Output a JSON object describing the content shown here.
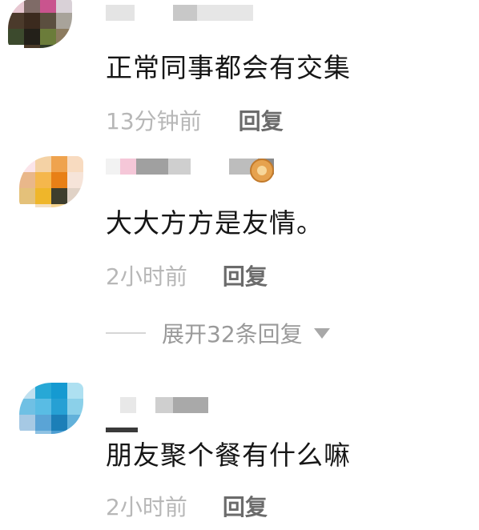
{
  "comments": [
    {
      "text": "正常同事都会有交集",
      "time": "13分钟前",
      "reply_label": "回复",
      "avatar_colors": [
        "#e7c7d1",
        "#7f6b67",
        "#c9548e",
        "#d9d1d7",
        "#4b3a2b",
        "#3b2a1e",
        "#5b4f3f",
        "#a8a39a",
        "#3c4a2d",
        "#232019",
        "#6b7c3a",
        "#8c7b5f",
        "#ffffff",
        "#4a3a29",
        "#2f3a26",
        "#cfa08b"
      ]
    },
    {
      "text": "大大方方是友情。",
      "time": "2小时前",
      "reply_label": "回复",
      "expand_label": "展开32条回复",
      "avatar_colors": [
        "#fbe4e9",
        "#f4d2a5",
        "#efa34e",
        "#f8dbc0",
        "#e9b78a",
        "#f5b74c",
        "#e88016",
        "#f6e4d9",
        "#e4c17a",
        "#efb62a",
        "#3e3e2d",
        "#e0d2c6",
        "#ffffff",
        "#f4e0c2",
        "#f7d590",
        "#a8b060"
      ]
    },
    {
      "text": "朋友聚个餐有什么嘛",
      "time": "2小时前",
      "reply_label": "回复",
      "avatar_colors": [
        "#bfe0ef",
        "#27a8d6",
        "#159ad1",
        "#aee0f1",
        "#6fc0e4",
        "#59bce4",
        "#26a0d4",
        "#8bd0e9",
        "#a6c9e4",
        "#5aa4d6",
        "#1c7fb8",
        "#62b1da",
        "#ffffff",
        "#8ec2e3",
        "#4d9ed2",
        "#c8e6f3"
      ]
    }
  ],
  "icons": {
    "lion": "lion-face-emoji",
    "expand": "triangle-down-icon"
  }
}
